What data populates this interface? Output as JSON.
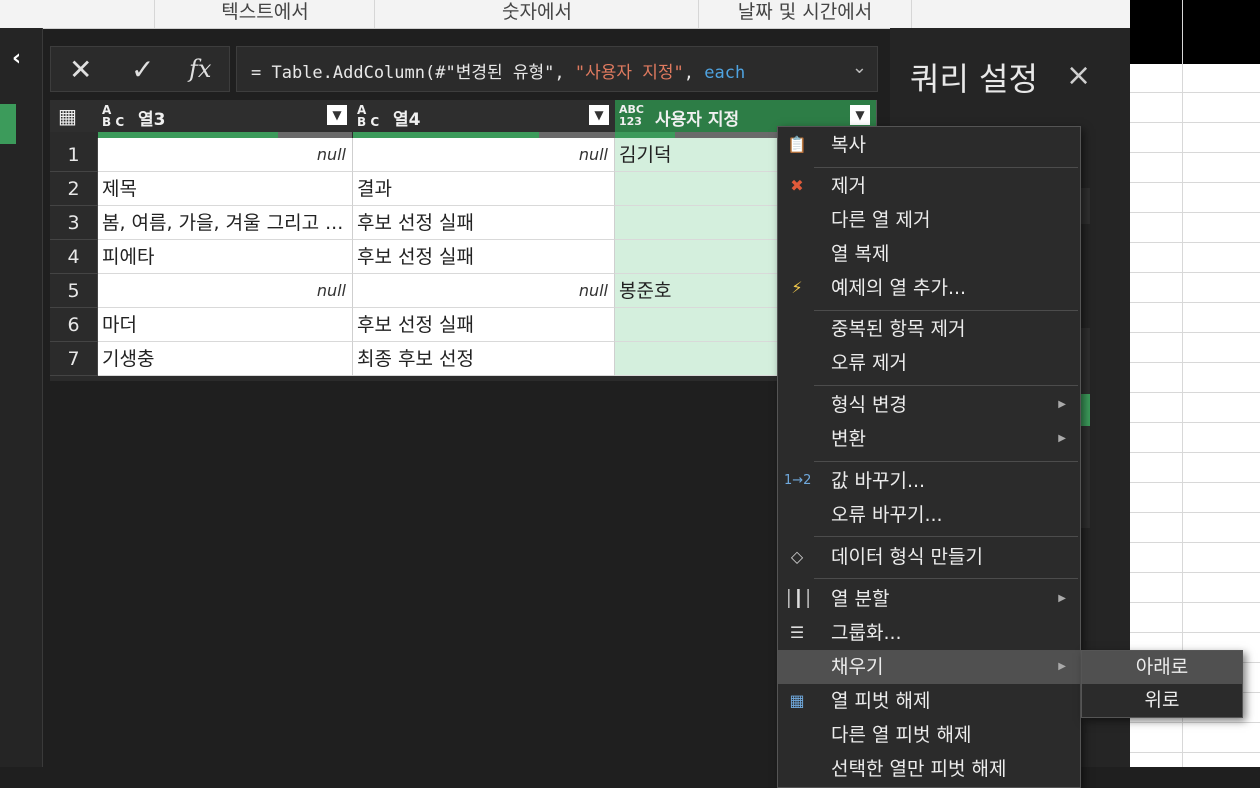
{
  "ribbon": {
    "groups": [
      "텍스트에서",
      "숫자에서",
      "날짜 및 시간에서"
    ]
  },
  "formula_bar": {
    "prefix": "= Table.AddColumn(#\"변경된 유형\", ",
    "string": "\"사용자 지정\"",
    "comma": ", ",
    "keyword": "each"
  },
  "icons": {
    "cancel": "close-icon",
    "confirm": "check-icon",
    "fx": "fx-icon",
    "expand": "chevron-down-icon",
    "collapse": "chevron-left-icon"
  },
  "grid": {
    "columns": [
      {
        "type_top": "A",
        "type_bottom": "B C",
        "name": "열3"
      },
      {
        "type_top": "A",
        "type_bottom": "B C",
        "name": "열4"
      },
      {
        "type_top": "ABC",
        "type_bottom": "123",
        "name": "사용자 지정"
      }
    ],
    "rows": [
      {
        "num": "1",
        "c3": "null",
        "c4": "null",
        "custom": "김기덕"
      },
      {
        "num": "2",
        "c3": "제목",
        "c4": "결과",
        "custom": ""
      },
      {
        "num": "3",
        "c3": "봄, 여름, 가을, 겨울 그리고 ...",
        "c4": "후보 선정 실패",
        "custom": ""
      },
      {
        "num": "4",
        "c3": "피에타",
        "c4": "후보 선정 실패",
        "custom": ""
      },
      {
        "num": "5",
        "c3": "null",
        "c4": "null",
        "custom": "봉준호"
      },
      {
        "num": "6",
        "c3": "마더",
        "c4": "후보 선정 실패",
        "custom": ""
      },
      {
        "num": "7",
        "c3": "기생충",
        "c4": "최종 후보 선정",
        "custom": ""
      }
    ]
  },
  "query_settings": {
    "title": "쿼리 설정",
    "close": "×"
  },
  "context_menu": {
    "items": [
      {
        "label": "복사"
      },
      {
        "label": "제거"
      },
      {
        "label": "다른 열 제거"
      },
      {
        "label": "열 복제"
      },
      {
        "label": "예제의 열 추가..."
      },
      {
        "label": "중복된 항목 제거"
      },
      {
        "label": "오류 제거"
      },
      {
        "label": "형식 변경"
      },
      {
        "label": "변환"
      },
      {
        "label": "값 바꾸기..."
      },
      {
        "label": "오류 바꾸기..."
      },
      {
        "label": "데이터 형식 만들기"
      },
      {
        "label": "열 분할"
      },
      {
        "label": "그룹화..."
      },
      {
        "label": "채우기"
      },
      {
        "label": "열 피벗 해제"
      },
      {
        "label": "다른 열 피벗 해제"
      },
      {
        "label": "선택한 열만 피벗 해제"
      }
    ]
  },
  "fill_submenu": {
    "items": [
      "아래로",
      "위로"
    ]
  },
  "colors": {
    "accent_green": "#2d7d46",
    "selected_cell": "#d4efdd",
    "menu_bg": "#2b2b2b"
  }
}
